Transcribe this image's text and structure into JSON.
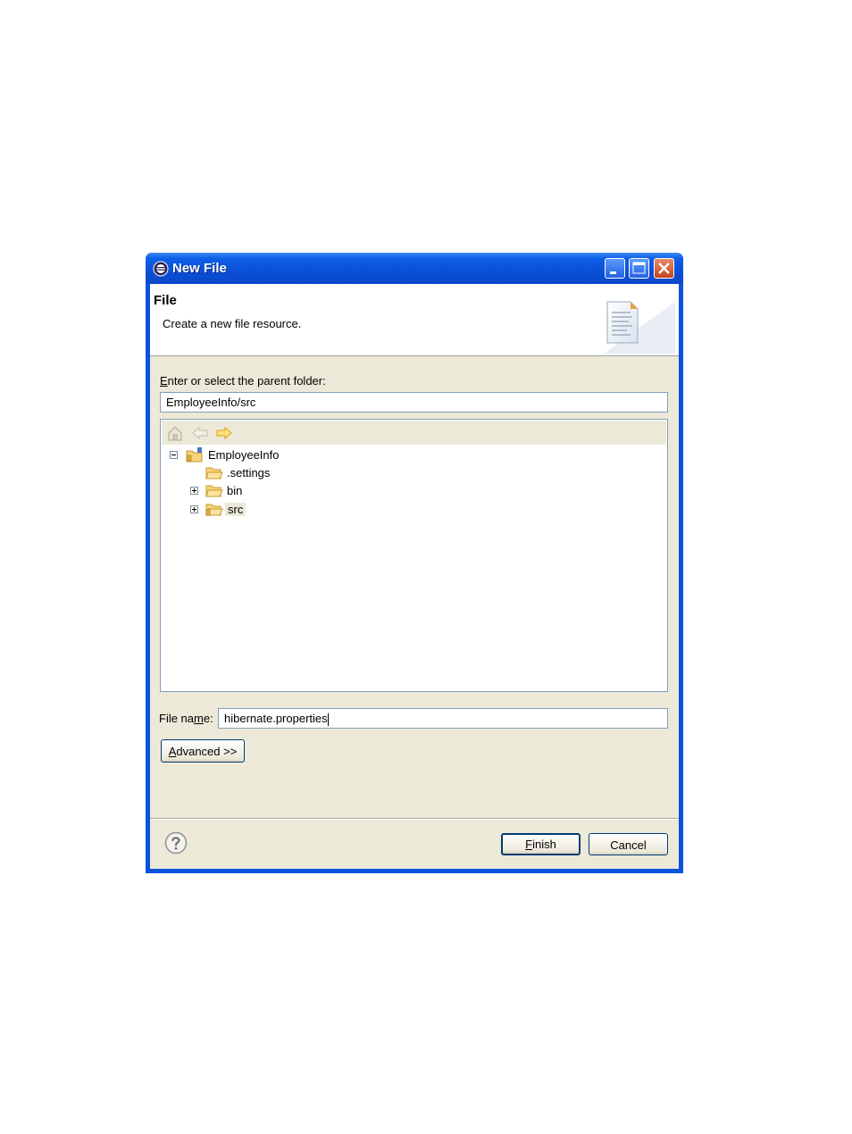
{
  "window": {
    "title": "New File"
  },
  "header": {
    "title": "File",
    "description": "Create a new file resource."
  },
  "parent_folder": {
    "label_accel": "E",
    "label_rest": "nter or select the parent folder:",
    "value": "EmployeeInfo/src"
  },
  "tree": {
    "toolbar": [
      "home-icon",
      "back-arrow-icon",
      "forward-arrow-icon"
    ],
    "items": [
      {
        "label": "EmployeeInfo",
        "expanded": true
      },
      {
        "label": ".settings"
      },
      {
        "label": "bin",
        "expandable": true
      },
      {
        "label": "src",
        "expandable": true,
        "selected": true
      }
    ]
  },
  "file_name": {
    "label_pre": "File na",
    "label_accel": "m",
    "label_post": "e:",
    "value": "hibernate.properties"
  },
  "advanced_button": {
    "accel": "A",
    "rest": "dvanced >>"
  },
  "footer": {
    "finish": {
      "accel": "F",
      "rest": "inish"
    },
    "cancel": "Cancel"
  },
  "colors": {
    "titlebar": "#0a52e0",
    "dialog_bg": "#ece9d8",
    "close_btn": "#c5421c"
  }
}
